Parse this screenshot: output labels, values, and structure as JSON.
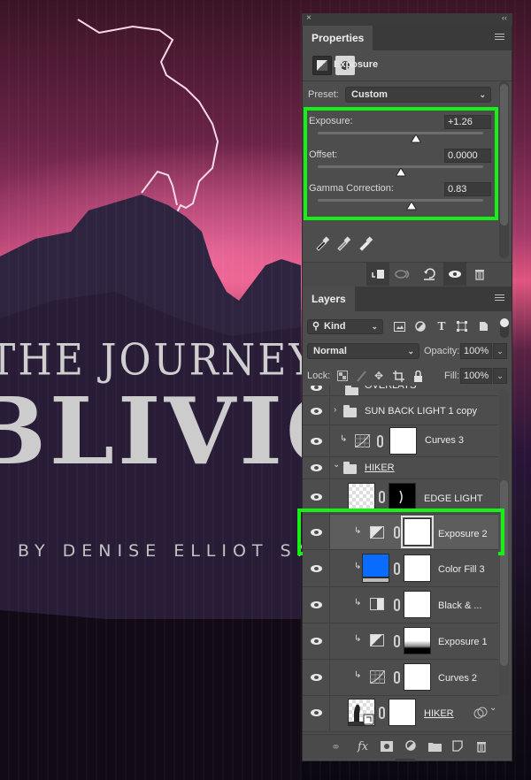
{
  "artwork": {
    "title_line1": "THE JOURNEY INTO",
    "title_line2": "BLIVIO",
    "author": "BY DENISE ELLIOT SMITH"
  },
  "panel_chrome": {
    "close_icon": "×",
    "collapse_icon": "‹‹"
  },
  "properties": {
    "tab_label": "Properties",
    "adjustment_name": "Exposure",
    "preset_label": "Preset:",
    "preset_value": "Custom",
    "sliders": [
      {
        "label": "Exposure:",
        "value": "+1.26",
        "position_fraction": 0.595
      },
      {
        "label": "Offset:",
        "value": "0.0000",
        "position_fraction": 0.5
      },
      {
        "label": "Gamma Correction:",
        "value": "0.83",
        "position_fraction": 0.565
      }
    ],
    "eyedroppers": [
      "black-point-eyedropper",
      "gray-point-eyedropper",
      "white-point-eyedropper"
    ],
    "footer_buttons": [
      "clip-to-layer",
      "view-previous-state",
      "reset-to-defaults",
      "toggle-visibility",
      "delete-adjustment"
    ]
  },
  "layers": {
    "tab_label": "Layers",
    "filter_kind": "Kind",
    "blend_mode": "Normal",
    "opacity_label": "Opacity:",
    "opacity_value": "100%",
    "lock_label": "Lock:",
    "fill_label": "Fill:",
    "fill_value": "100%",
    "rows": [
      {
        "name": "OVERLAYS",
        "type": "group",
        "expanded": false,
        "partial": true
      },
      {
        "name": "SUN BACK LIGHT 1 copy",
        "type": "group",
        "expanded": false
      },
      {
        "name": "Curves 3",
        "type": "curves",
        "clipped": true
      },
      {
        "name": "HIKER",
        "type": "group",
        "expanded": true
      },
      {
        "name": "EDGE LIGHT",
        "type": "pixel-with-mask"
      },
      {
        "name": "Exposure 2",
        "type": "exposure",
        "clipped": true,
        "selected": true
      },
      {
        "name": "Color Fill 3",
        "type": "color-fill",
        "clipped": true,
        "fill_color": "#0a6cff"
      },
      {
        "name": "Black & ...",
        "type": "black-white",
        "clipped": true
      },
      {
        "name": "Exposure 1",
        "type": "exposure",
        "clipped": true
      },
      {
        "name": "Curves 2",
        "type": "curves",
        "clipped": true
      },
      {
        "name": "HIKER",
        "type": "smart-object"
      }
    ],
    "footer_buttons": [
      "link-layers",
      "fx",
      "add-mask",
      "new-fill-adjustment",
      "new-group",
      "new-layer",
      "delete-layer"
    ]
  },
  "colors": {
    "highlight": "#16f016",
    "panel_bg": "#4d4d4d",
    "color_fill": "#0a6cff"
  }
}
